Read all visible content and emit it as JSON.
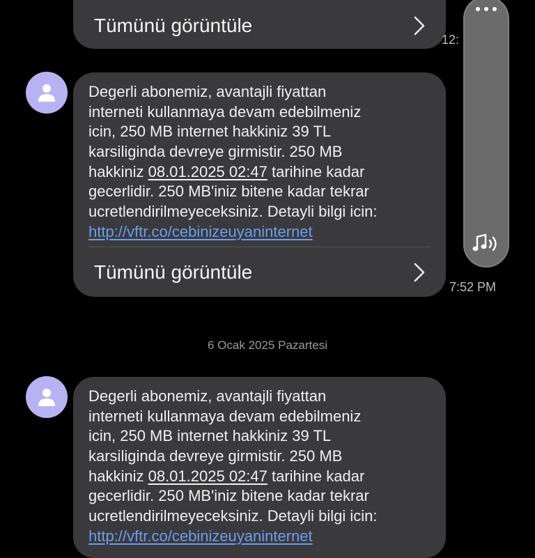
{
  "messages": [
    {
      "view_all_label": "Tümünü görüntüle",
      "time": "12:"
    },
    {
      "lines": [
        "Degerli abonemiz, avantajli fiyattan",
        "interneti kullanmaya devam edebilmeniz",
        "icin, 250 MB internet hakkiniz 39 TL",
        "karsiliginda devreye girmistir. 250 MB"
      ],
      "line5_prefix": "hakkiniz ",
      "date_link": "08.01.2025 02:47",
      "line5_suffix": " tarihine kadar",
      "lines_after": [
        "gecerlidir. 250 MB'iniz bitene kadar tekrar",
        "ucretlendirilmeyeceksiniz. Detayli bilgi icin:"
      ],
      "url": "http://vftr.co/cebinizeuyaninternet",
      "view_all_label": "Tümünü görüntüle",
      "time": "7:52 PM"
    },
    {
      "lines": [
        "Degerli abonemiz, avantajli fiyattan",
        "interneti kullanmaya devam edebilmeniz",
        "icin, 250 MB internet hakkiniz 39 TL",
        "karsiliginda devreye girmistir. 250 MB"
      ],
      "line5_prefix": "hakkiniz ",
      "date_link": "08.01.2025 02:47",
      "line5_suffix": " tarihine kadar",
      "lines_after": [
        "gecerlidir. 250 MB'iniz bitene kadar tekrar",
        "ucretlendirilmeyeceksiniz. Detayli bilgi icin:"
      ],
      "url": "http://vftr.co/cebinizeuyaninternet"
    }
  ],
  "date_separator": "6 Ocak 2025 Pazartesi",
  "icons": {
    "avatar": "person-icon",
    "chevron": "chevron-right-icon",
    "more": "more-dots-icon",
    "sound": "sound-icon"
  },
  "colors": {
    "background": "#000000",
    "bubble": "#3a3a3c",
    "avatar": "#b7b3f2",
    "link": "#6e9cf0"
  }
}
